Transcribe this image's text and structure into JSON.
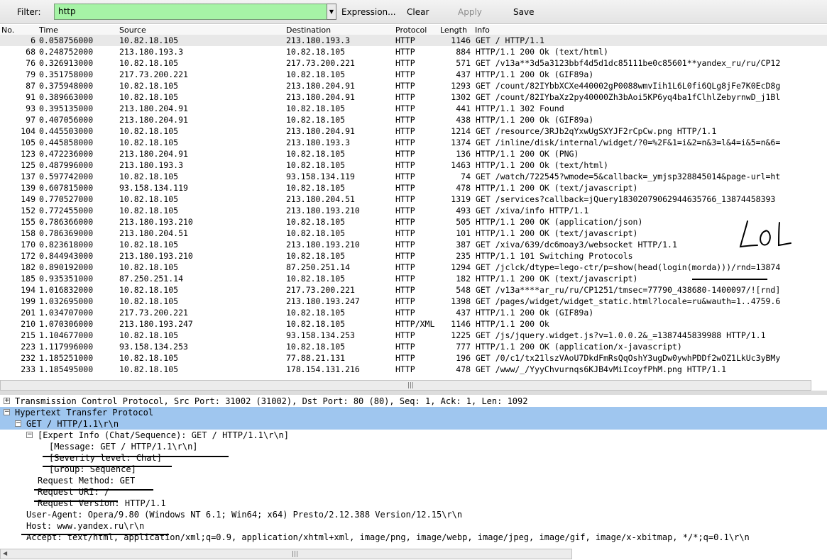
{
  "toolbar": {
    "filter_label": "Filter:",
    "filter_value": "http",
    "expression": "Expression...",
    "clear": "Clear",
    "apply": "Apply",
    "save": "Save"
  },
  "columns": {
    "no": "No.",
    "time": "Time",
    "source": "Source",
    "destination": "Destination",
    "protocol": "Protocol",
    "length": "Length",
    "info": "Info"
  },
  "packets": [
    {
      "no": "6",
      "time": "0.058756000",
      "src": "10.82.18.105",
      "dst": "213.180.193.3",
      "proto": "HTTP",
      "len": "1146",
      "info": "GET / HTTP/1.1"
    },
    {
      "no": "68",
      "time": "0.248752000",
      "src": "213.180.193.3",
      "dst": "10.82.18.105",
      "proto": "HTTP",
      "len": "884",
      "info": "HTTP/1.1 200 Ok  (text/html)"
    },
    {
      "no": "76",
      "time": "0.326913000",
      "src": "10.82.18.105",
      "dst": "217.73.200.221",
      "proto": "HTTP",
      "len": "571",
      "info": "GET /v13a**3d5a3123bbf4d5d1dc85111be0c85601**yandex_ru/ru/CP12"
    },
    {
      "no": "79",
      "time": "0.351758000",
      "src": "217.73.200.221",
      "dst": "10.82.18.105",
      "proto": "HTTP",
      "len": "437",
      "info": "HTTP/1.1 200 Ok  (GIF89a)"
    },
    {
      "no": "87",
      "time": "0.375948000",
      "src": "10.82.18.105",
      "dst": "213.180.204.91",
      "proto": "HTTP",
      "len": "1293",
      "info": "GET /count/82IYbbXCXe440002gP0088wmvIih1L6L0fi6QLg8jFe7K0EcD8g"
    },
    {
      "no": "91",
      "time": "0.389663000",
      "src": "10.82.18.105",
      "dst": "213.180.204.91",
      "proto": "HTTP",
      "len": "1302",
      "info": "GET /count/82IYbaXz2py40000Zh3bAoi5KP6yq4ba1fClhlZebyrnwD_j1Bl"
    },
    {
      "no": "93",
      "time": "0.395135000",
      "src": "213.180.204.91",
      "dst": "10.82.18.105",
      "proto": "HTTP",
      "len": "441",
      "info": "HTTP/1.1 302 Found"
    },
    {
      "no": "97",
      "time": "0.407056000",
      "src": "213.180.204.91",
      "dst": "10.82.18.105",
      "proto": "HTTP",
      "len": "438",
      "info": "HTTP/1.1 200 Ok  (GIF89a)"
    },
    {
      "no": "104",
      "time": "0.445503000",
      "src": "10.82.18.105",
      "dst": "213.180.204.91",
      "proto": "HTTP",
      "len": "1214",
      "info": "GET /resource/3RJb2qYxwUgSXYJF2rCpCw.png HTTP/1.1"
    },
    {
      "no": "105",
      "time": "0.445858000",
      "src": "10.82.18.105",
      "dst": "213.180.193.3",
      "proto": "HTTP",
      "len": "1374",
      "info": "GET /inline/disk/internal/widget/?0=%2F&1=i&2=n&3=l&4=i&5=n&6="
    },
    {
      "no": "123",
      "time": "0.472236000",
      "src": "213.180.204.91",
      "dst": "10.82.18.105",
      "proto": "HTTP",
      "len": "136",
      "info": "HTTP/1.1 200 OK  (PNG)"
    },
    {
      "no": "125",
      "time": "0.487996000",
      "src": "213.180.193.3",
      "dst": "10.82.18.105",
      "proto": "HTTP",
      "len": "1463",
      "info": "HTTP/1.1 200 Ok  (text/html)"
    },
    {
      "no": "137",
      "time": "0.597742000",
      "src": "10.82.18.105",
      "dst": "93.158.134.119",
      "proto": "HTTP",
      "len": "74",
      "info": "GET /watch/722545?wmode=5&callback=_ymjsp328845014&page-url=ht"
    },
    {
      "no": "139",
      "time": "0.607815000",
      "src": "93.158.134.119",
      "dst": "10.82.18.105",
      "proto": "HTTP",
      "len": "478",
      "info": "HTTP/1.1 200 OK  (text/javascript)"
    },
    {
      "no": "149",
      "time": "0.770527000",
      "src": "10.82.18.105",
      "dst": "213.180.204.51",
      "proto": "HTTP",
      "len": "1319",
      "info": "GET /services?callback=jQuery18302079062944635766_13874458393"
    },
    {
      "no": "152",
      "time": "0.772455000",
      "src": "10.82.18.105",
      "dst": "213.180.193.210",
      "proto": "HTTP",
      "len": "493",
      "info": "GET /xiva/info HTTP/1.1"
    },
    {
      "no": "155",
      "time": "0.786366000",
      "src": "213.180.193.210",
      "dst": "10.82.18.105",
      "proto": "HTTP",
      "len": "505",
      "info": "HTTP/1.1 200 OK  (application/json)"
    },
    {
      "no": "158",
      "time": "0.786369000",
      "src": "213.180.204.51",
      "dst": "10.82.18.105",
      "proto": "HTTP",
      "len": "101",
      "info": "HTTP/1.1 200 OK  (text/javascript)"
    },
    {
      "no": "170",
      "time": "0.823618000",
      "src": "10.82.18.105",
      "dst": "213.180.193.210",
      "proto": "HTTP",
      "len": "387",
      "info": "GET /xiva/639/dc6moay3/websocket HTTP/1.1"
    },
    {
      "no": "172",
      "time": "0.844943000",
      "src": "213.180.193.210",
      "dst": "10.82.18.105",
      "proto": "HTTP",
      "len": "235",
      "info": "HTTP/1.1 101 Switching Protocols"
    },
    {
      "no": "182",
      "time": "0.890192000",
      "src": "10.82.18.105",
      "dst": "87.250.251.14",
      "proto": "HTTP",
      "len": "1294",
      "info": "GET /jclck/dtype=lego-ctr/p=show(head(login(morda)))/rnd=13874"
    },
    {
      "no": "185",
      "time": "0.935351000",
      "src": "87.250.251.14",
      "dst": "10.82.18.105",
      "proto": "HTTP",
      "len": "182",
      "info": "HTTP/1.1 200 OK  (text/javascript)"
    },
    {
      "no": "194",
      "time": "1.016832000",
      "src": "10.82.18.105",
      "dst": "217.73.200.221",
      "proto": "HTTP",
      "len": "548",
      "info": "GET /v13a****ar_ru/ru/CP1251/tmsec=77790_438680-1400097/![rnd]"
    },
    {
      "no": "199",
      "time": "1.032695000",
      "src": "10.82.18.105",
      "dst": "213.180.193.247",
      "proto": "HTTP",
      "len": "1398",
      "info": "GET /pages/widget/widget_static.html?locale=ru&wauth=1..4759.6"
    },
    {
      "no": "201",
      "time": "1.034707000",
      "src": "217.73.200.221",
      "dst": "10.82.18.105",
      "proto": "HTTP",
      "len": "437",
      "info": "HTTP/1.1 200 Ok  (GIF89a)"
    },
    {
      "no": "210",
      "time": "1.070306000",
      "src": "213.180.193.247",
      "dst": "10.82.18.105",
      "proto": "HTTP/XML",
      "len": "1146",
      "info": "HTTP/1.1 200 Ok"
    },
    {
      "no": "215",
      "time": "1.104677000",
      "src": "10.82.18.105",
      "dst": "93.158.134.253",
      "proto": "HTTP",
      "len": "1225",
      "info": "GET /js/jquery.widget.js?v=1.0.0.2&_=1387445839988 HTTP/1.1"
    },
    {
      "no": "223",
      "time": "1.117996000",
      "src": "93.158.134.253",
      "dst": "10.82.18.105",
      "proto": "HTTP",
      "len": "777",
      "info": "HTTP/1.1 200 OK  (application/x-javascript)"
    },
    {
      "no": "232",
      "time": "1.185251000",
      "src": "10.82.18.105",
      "dst": "77.88.21.131",
      "proto": "HTTP",
      "len": "196",
      "info": "GET /0/c1/tx21lszVAoU7DkdFmRsQqOshY3ugDw0ywhPDDf2wOZ1LkUc3yBMy"
    },
    {
      "no": "233",
      "time": "1.185495000",
      "src": "10.82.18.105",
      "dst": "178.154.131.216",
      "proto": "HTTP",
      "len": "478",
      "info": "GET /www/_/YyyChvurnqs6KJB4vMiIcoyfPhM.png HTTP/1.1"
    }
  ],
  "details": [
    {
      "indent": 0,
      "toggle": "+",
      "text": "Transmission Control Protocol, Src Port: 31002 (31002), Dst Port: 80 (80), Seq: 1, Ack: 1, Len: 1092",
      "hl": false
    },
    {
      "indent": 0,
      "toggle": "-",
      "text": "Hypertext Transfer Protocol",
      "hl": true
    },
    {
      "indent": 1,
      "toggle": "-",
      "text": "GET / HTTP/1.1\\r\\n",
      "hl": true
    },
    {
      "indent": 2,
      "toggle": "-",
      "text": "[Expert Info (Chat/Sequence): GET / HTTP/1.1\\r\\n]",
      "hl": false
    },
    {
      "indent": 3,
      "toggle": "",
      "text": "[Message: GET / HTTP/1.1\\r\\n]",
      "hl": false
    },
    {
      "indent": 3,
      "toggle": "",
      "text": "[Severity level: Chat]",
      "hl": false
    },
    {
      "indent": 3,
      "toggle": "",
      "text": "[Group: Sequence]",
      "hl": false
    },
    {
      "indent": 2,
      "toggle": "",
      "text": "Request Method: GET",
      "hl": false
    },
    {
      "indent": 2,
      "toggle": "",
      "text": "Request URI: /",
      "hl": false
    },
    {
      "indent": 2,
      "toggle": "",
      "text": "Request Version: HTTP/1.1",
      "hl": false
    },
    {
      "indent": 1,
      "toggle": "",
      "text": "User-Agent: Opera/9.80 (Windows NT 6.1; Win64; x64) Presto/2.12.388 Version/12.15\\r\\n",
      "hl": false
    },
    {
      "indent": 1,
      "toggle": "",
      "text": "Host: www.yandex.ru\\r\\n",
      "hl": false
    },
    {
      "indent": 1,
      "toggle": "",
      "text": "Accept: text/html, application/xml;q=0.9, application/xhtml+xml, image/png, image/webp, image/jpeg, image/gif, image/x-xbitmap, */*;q=0.1\\r\\n",
      "hl": false
    }
  ],
  "annotation": {
    "text": "LOL",
    "color": "#000000"
  },
  "colors": {
    "filter_bg": "#a6f3a6",
    "detail_highlight": "#9fc6ef"
  }
}
